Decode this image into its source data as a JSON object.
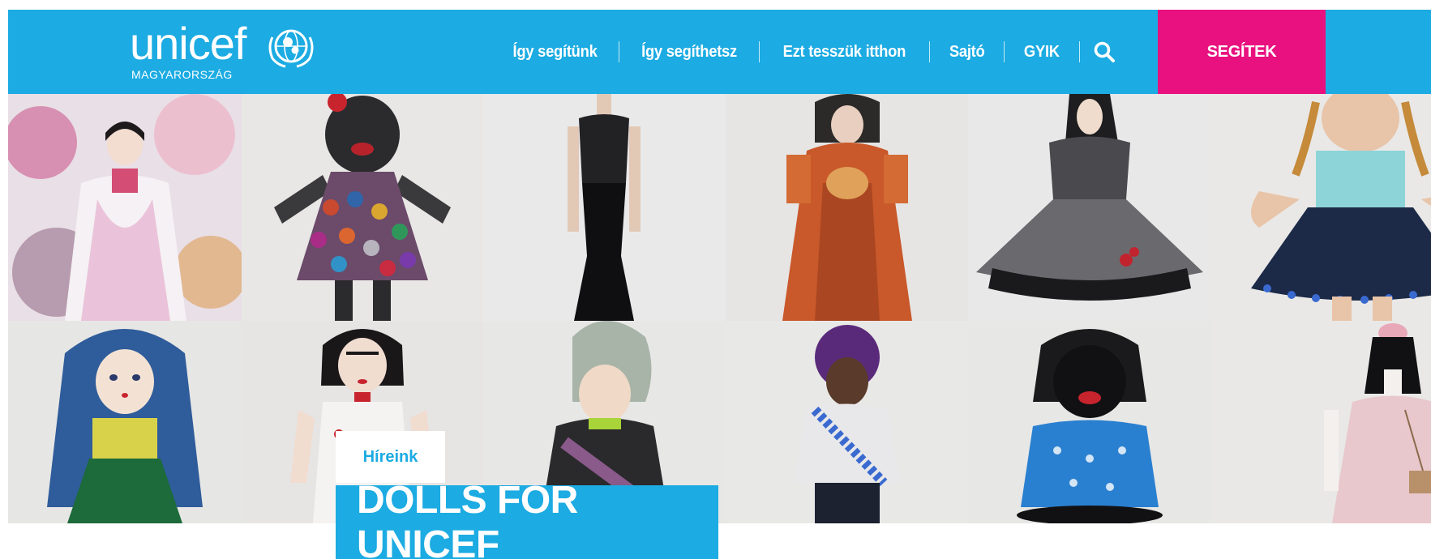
{
  "brand": {
    "logo_word": "unicef",
    "logo_sub": "MAGYARORSZÁG",
    "color_primary": "#1cabe2",
    "color_donate": "#e8117f"
  },
  "nav": {
    "items": [
      {
        "label": "Így segítünk"
      },
      {
        "label": "Így segíthetsz"
      },
      {
        "label": "Ezt tesszük itthon"
      },
      {
        "label": "Sajtó"
      },
      {
        "label": "GYIK"
      }
    ],
    "search_icon": "search-icon",
    "donate_label": "SEGÍTEK"
  },
  "hero": {
    "tag_label": "Híreink",
    "headline": "DOLLS FOR UNICEF"
  }
}
